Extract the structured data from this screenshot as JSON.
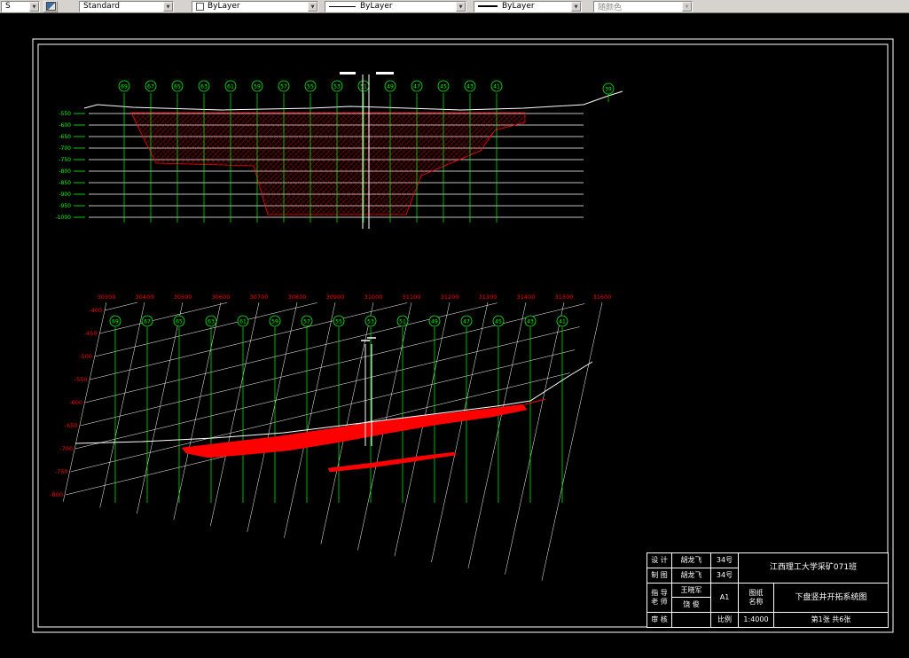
{
  "toolbar": {
    "layer_combo_value": "S",
    "style_combo_value": "Standard",
    "color_combo_value": "ByLayer",
    "linetype_combo_value": "ByLayer",
    "lineweight_combo_value": "ByLayer",
    "plot_style_combo_value": "随颜色"
  },
  "section_view": {
    "stations": [
      "69",
      "67",
      "65",
      "63",
      "61",
      "59",
      "57",
      "55",
      "53",
      "51",
      "49",
      "47",
      "45",
      "43",
      "41"
    ],
    "right_station": "39",
    "elevations": [
      "-550",
      "-600",
      "-650",
      "-700",
      "-750",
      "-800",
      "-850",
      "-900",
      "-950",
      "-1000"
    ]
  },
  "plan_view": {
    "top_coords": [
      "30300",
      "30400",
      "30500",
      "30600",
      "30700",
      "30800",
      "30900",
      "31000",
      "31100",
      "31200",
      "31300",
      "31400",
      "31500",
      "31600"
    ],
    "left_elevations": [
      "-400",
      "-450",
      "-500",
      "-550",
      "-600",
      "-650",
      "-700",
      "-750",
      "-800"
    ],
    "stations": [
      "69",
      "67",
      "65",
      "63",
      "61",
      "59",
      "57",
      "55",
      "53",
      "51",
      "49",
      "47",
      "45",
      "43",
      "41"
    ]
  },
  "title_block": {
    "design_label": "设 计",
    "design_name": "胡龙飞",
    "design_no": "34号",
    "draft_label": "制 图",
    "draft_name": "胡龙飞",
    "draft_no": "34号",
    "advisor_label_top": "指 导",
    "advisor_label_bottom": "老 师",
    "advisor_name_top": "王晓军",
    "advisor_name_bottom": "饶 俊",
    "paper_size": "A1",
    "school": "江西理工大学采矿071班",
    "sheet_name_label_top": "图纸",
    "sheet_name_label_bottom": "名称",
    "drawing_name": "下盘竖井开拓系统图",
    "review_label": "审 核",
    "scale_label": "比例",
    "scale_value": "1:4000",
    "sheet_count": "第1张  共6张"
  },
  "colors": {
    "station_green": "#00ff00",
    "ore_red": "#ff0000",
    "line_white": "#ffffff",
    "toolbar_bg": "#d6d3ce"
  }
}
